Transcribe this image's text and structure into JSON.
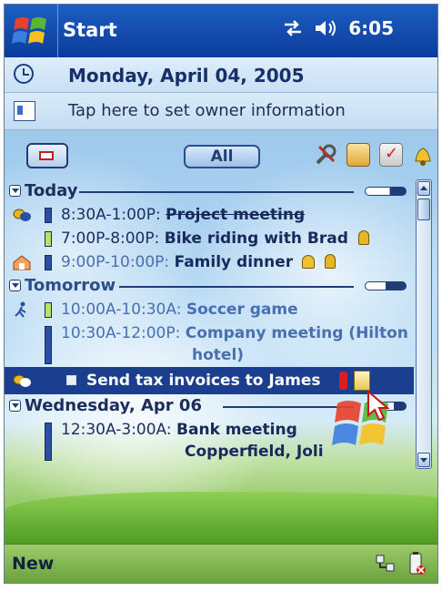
{
  "titlebar": {
    "title": "Start",
    "time": "6:05",
    "connectivity_icon": "sync-arrows-icon",
    "volume_icon": "speaker-icon"
  },
  "today": {
    "date": "Monday, April 04, 2005",
    "owner_text": "Tap here to set owner information"
  },
  "toolbar": {
    "filter_label": "All"
  },
  "sections": {
    "today_label": "Today",
    "tomorrow_label": "Tomorrow",
    "wednesday_label": "Wednesday, Apr 06"
  },
  "appointments": {
    "a1_time": "8:30A-1:00P:",
    "a1_subject": "Project meeting",
    "a2_time": "7:00P-8:00P:",
    "a2_subject": "Bike riding with Brad",
    "a3_time": "9:00P-10:00P:",
    "a3_subject": "Family dinner",
    "a4_time": "10:00A-10:30A:",
    "a4_subject": "Soccer game",
    "a5_time": "10:30A-12:00P:",
    "a5_subject": "Company meeting (Hilton",
    "a5_subject_line2": "hotel)",
    "a6_time": "12:30A-3:00A:",
    "a6_subject": "Bank meeting",
    "a6_subject_line2": "Copperfield, Joli"
  },
  "task": {
    "label": "Send tax invoices to James"
  },
  "bottombar": {
    "new_label": "New"
  },
  "colors": {
    "titlebar": "#0b3b9b",
    "selection": "#1c3e8f",
    "bottombar": "#6aa23c",
    "accent_text": "#172a5b"
  }
}
